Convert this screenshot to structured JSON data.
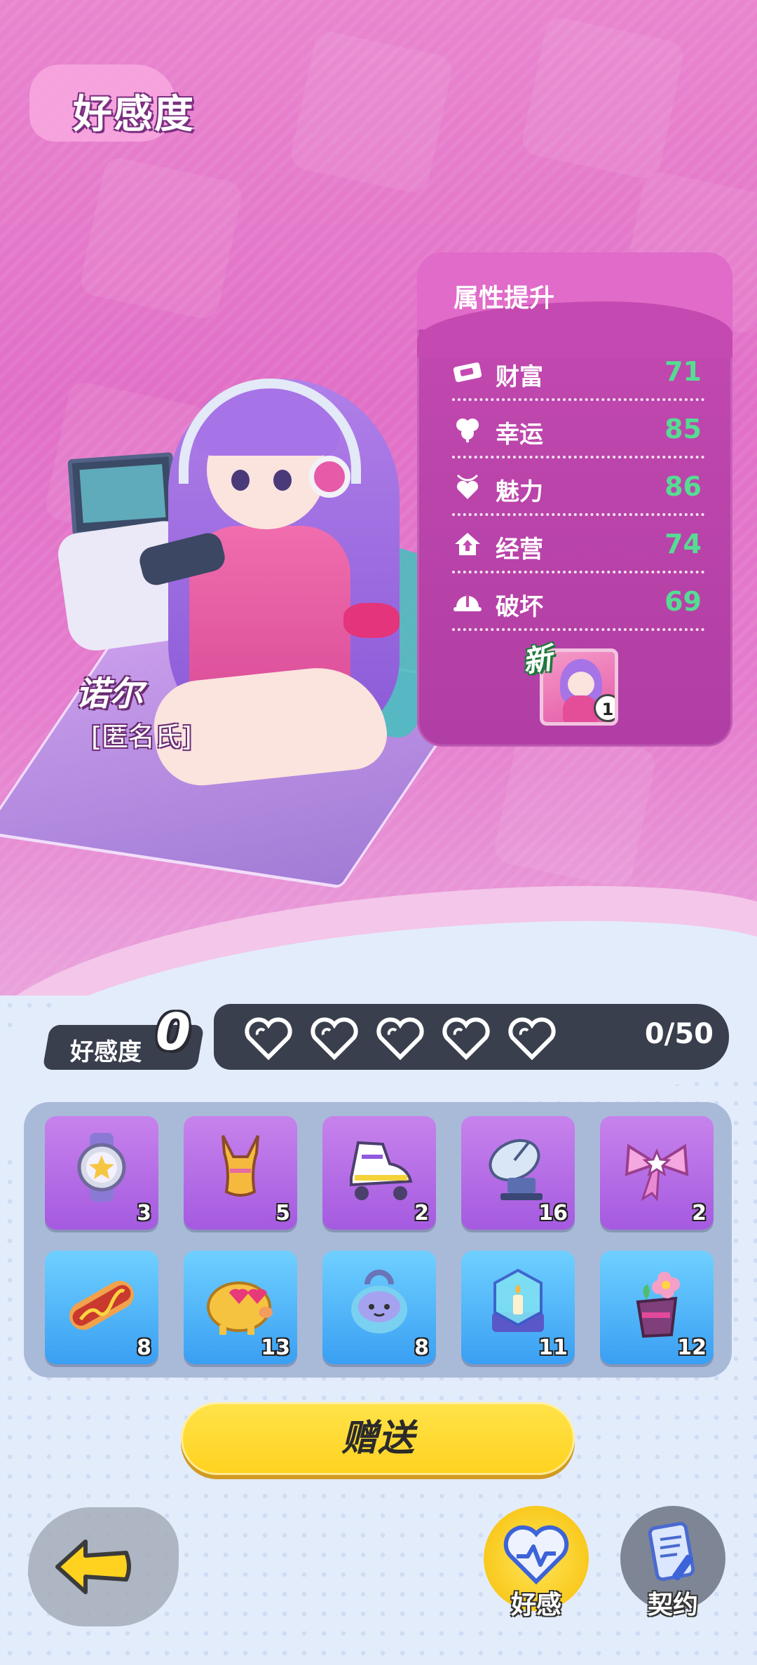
{
  "page": {
    "title": "好感度"
  },
  "character": {
    "name": "诺尔",
    "title": "[匿名氏]"
  },
  "attributes": {
    "title": "属性提升",
    "items": [
      {
        "icon": "ticket-icon",
        "label": "财富",
        "value": "71"
      },
      {
        "icon": "clover-icon",
        "label": "幸运",
        "value": "85"
      },
      {
        "icon": "heart-necklace-icon",
        "label": "魅力",
        "value": "86"
      },
      {
        "icon": "house-up-icon",
        "label": "经营",
        "value": "74"
      },
      {
        "icon": "hard-hat-icon",
        "label": "破坏",
        "value": "69"
      }
    ],
    "new_tag": "新",
    "new_card_count": "1"
  },
  "favor": {
    "label": "好感度",
    "level": "0",
    "hearts_total": 5,
    "progress": "0/50"
  },
  "gifts": [
    {
      "icon": "watch-icon",
      "count": "3",
      "bg": "purple"
    },
    {
      "icon": "swimsuit-icon",
      "count": "5",
      "bg": "purple"
    },
    {
      "icon": "roller-skate-icon",
      "count": "2",
      "bg": "purple"
    },
    {
      "icon": "satellite-dish-icon",
      "count": "16",
      "bg": "purple"
    },
    {
      "icon": "ribbon-bow-icon",
      "count": "2",
      "bg": "purple"
    },
    {
      "icon": "hotdog-icon",
      "count": "8",
      "bg": "blue"
    },
    {
      "icon": "piggy-bank-icon",
      "count": "13",
      "bg": "blue"
    },
    {
      "icon": "slime-weight-icon",
      "count": "8",
      "bg": "blue"
    },
    {
      "icon": "candle-box-icon",
      "count": "11",
      "bg": "blue"
    },
    {
      "icon": "flower-pot-icon",
      "count": "12",
      "bg": "blue"
    }
  ],
  "actions": {
    "gift_button": "赠送"
  },
  "nav": {
    "favor_label": "好感",
    "contract_label": "契约"
  },
  "colors": {
    "accent_pink": "#e16fc6",
    "value_green": "#56dc92",
    "button_yellow": "#ffd21f"
  }
}
